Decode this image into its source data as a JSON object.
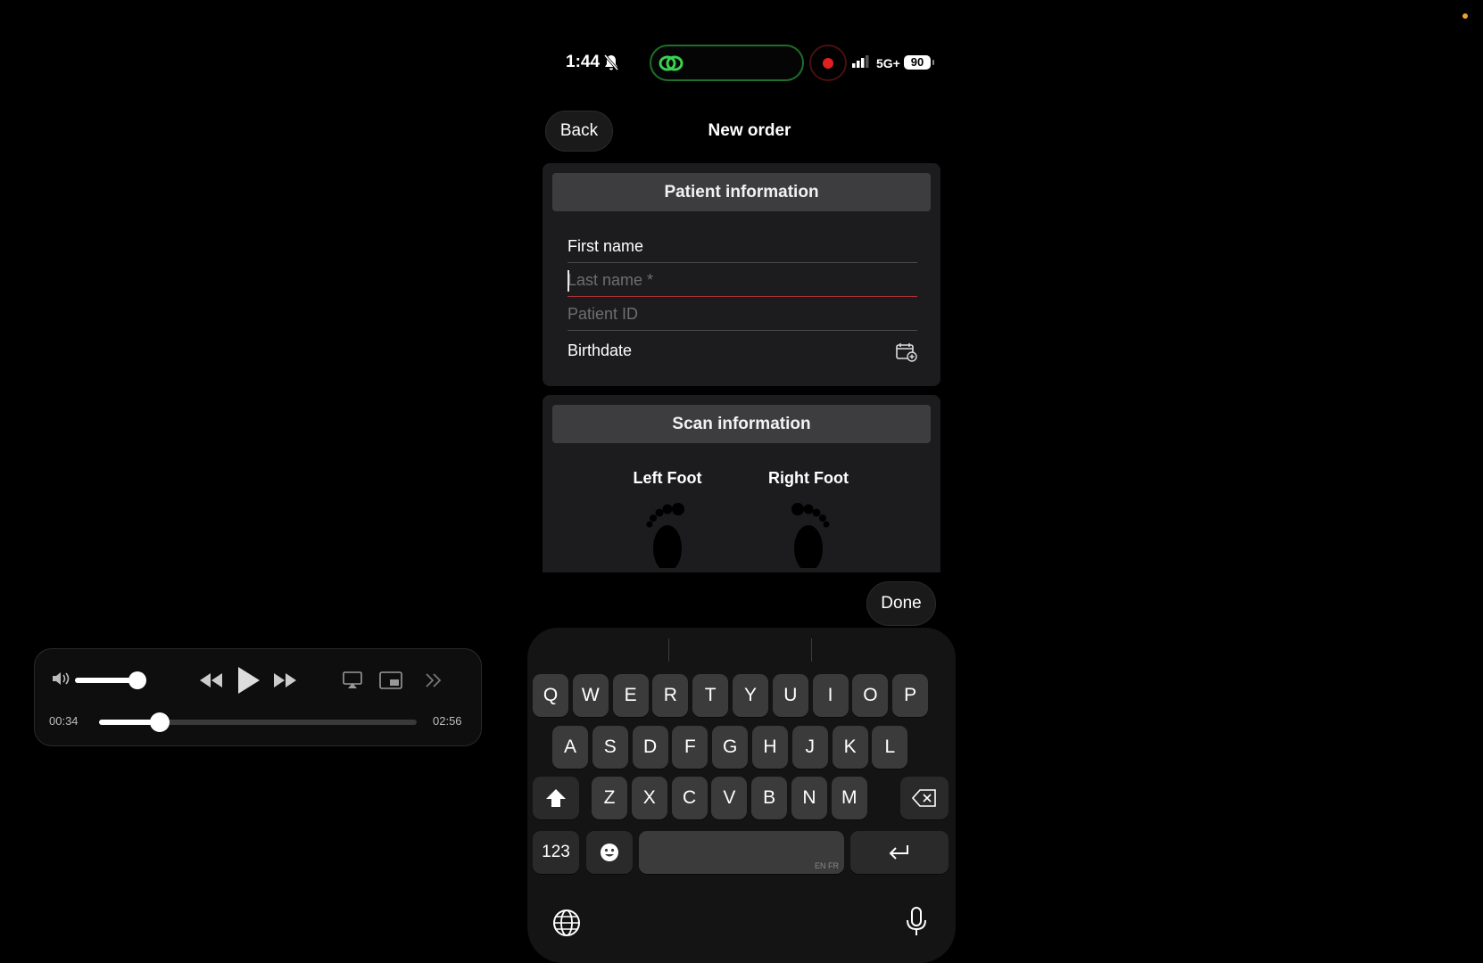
{
  "colors": {
    "background": "#000000",
    "card": "#1c1c1e",
    "card_header": "#3d3d40",
    "invalid_underline": "#a83232",
    "record_dot": "#e02020",
    "pill_border": "#1f6e2a",
    "link_icon": "#3cd050",
    "desktop_dot": "#f0a030"
  },
  "player": {
    "volume_level": 0.9,
    "progress_fraction": 0.19,
    "elapsed": "00:34",
    "duration": "02:56",
    "icons": [
      "speaker-volume-icon",
      "rewind-icon",
      "play-icon",
      "fast-forward-icon",
      "airplay-icon",
      "picture-in-picture-icon",
      "chevrons-right-icon"
    ]
  },
  "status_bar": {
    "time": "1:44",
    "network": "5G+",
    "battery": "90",
    "icons": [
      "bell-slash-icon",
      "link-icon",
      "record-icon",
      "signal-bars-icon"
    ]
  },
  "nav": {
    "back_label": "Back",
    "title": "New order"
  },
  "patient": {
    "header": "Patient information",
    "first_name_label": "First name",
    "last_name_placeholder": "Last name *",
    "patient_id_placeholder": "Patient ID",
    "birthdate_label": "Birthdate"
  },
  "scan": {
    "header": "Scan information",
    "left_label": "Left Foot",
    "right_label": "Right Foot"
  },
  "done_label": "Done",
  "keyboard": {
    "row1": [
      "Q",
      "W",
      "E",
      "R",
      "T",
      "Y",
      "U",
      "I",
      "O",
      "P"
    ],
    "row2": [
      "A",
      "S",
      "D",
      "F",
      "G",
      "H",
      "J",
      "K",
      "L"
    ],
    "row3": [
      "Z",
      "X",
      "C",
      "V",
      "B",
      "N",
      "M"
    ],
    "numbers_label": "123",
    "space_languages": "EN FR",
    "icons": [
      "shift-icon",
      "backspace-icon",
      "emoji-icon",
      "return-icon",
      "globe-icon",
      "microphone-icon"
    ]
  }
}
